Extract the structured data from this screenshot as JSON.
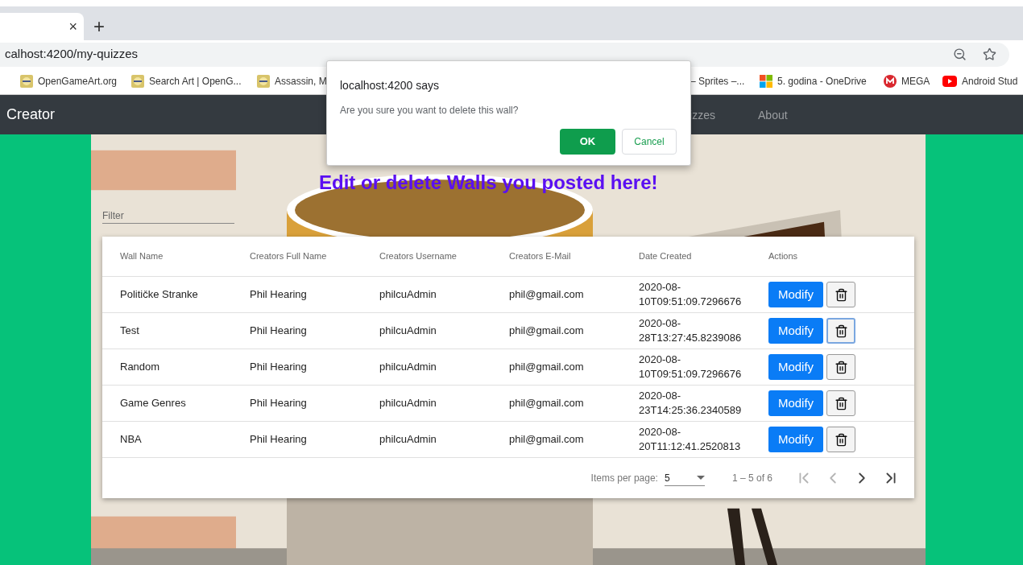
{
  "browser": {
    "tab_close": "×",
    "new_tab": "+",
    "address": "calhost:4200/my-quizzes",
    "bookmarks": [
      {
        "label": "OpenGameArt.org",
        "kind": "sprite"
      },
      {
        "label": "Search Art | OpenG...",
        "kind": "sprite"
      },
      {
        "label": "Assassin, M",
        "kind": "sprite"
      },
      {
        "label": "– Sprites –...",
        "kind": "none"
      },
      {
        "label": "5. godina - OneDrive",
        "kind": "windows"
      },
      {
        "label": "MEGA",
        "kind": "mega"
      },
      {
        "label": "Android Stud",
        "kind": "youtube"
      }
    ]
  },
  "navbar": {
    "brand": "Creator",
    "links": [
      "izzes",
      "About"
    ]
  },
  "dialog": {
    "title": "localhost:4200 says",
    "message": "Are you sure you want to delete this wall?",
    "ok": "OK",
    "cancel": "Cancel"
  },
  "page": {
    "heading": "Edit or delete Walls you posted here!",
    "filter": {
      "placeholder": "Filter"
    }
  },
  "table": {
    "columns": [
      "Wall Name",
      "Creators Full Name",
      "Creators Username",
      "Creators E-Mail",
      "Date Created",
      "Actions"
    ],
    "rows": [
      {
        "cells": [
          "Političke Stranke",
          "Phil Hearing",
          "philcuAdmin",
          "phil@gmail.com",
          "2020-08-10T09:51:09.7296676"
        ],
        "modify": "Modify",
        "delete_focused": false
      },
      {
        "cells": [
          "Test",
          "Phil Hearing",
          "philcuAdmin",
          "phil@gmail.com",
          "2020-08-28T13:27:45.8239086"
        ],
        "modify": "Modify",
        "delete_focused": true
      },
      {
        "cells": [
          "Random",
          "Phil Hearing",
          "philcuAdmin",
          "phil@gmail.com",
          "2020-08-10T09:51:09.7296676"
        ],
        "modify": "Modify",
        "delete_focused": false
      },
      {
        "cells": [
          "Game Genres",
          "Phil Hearing",
          "philcuAdmin",
          "phil@gmail.com",
          "2020-08-23T14:25:36.2340589"
        ],
        "modify": "Modify",
        "delete_focused": false
      },
      {
        "cells": [
          "NBA",
          "Phil Hearing",
          "philcuAdmin",
          "phil@gmail.com",
          "2020-08-20T11:12:41.2520813"
        ],
        "modify": "Modify",
        "delete_focused": false
      }
    ]
  },
  "paginator": {
    "label": "Items per page:",
    "page_size": "5",
    "range": "1 – 5 of 6",
    "buttons": [
      {
        "kind": "first",
        "disabled": true
      },
      {
        "kind": "prev",
        "disabled": true
      },
      {
        "kind": "next",
        "disabled": false
      },
      {
        "kind": "last",
        "disabled": false
      }
    ]
  }
}
